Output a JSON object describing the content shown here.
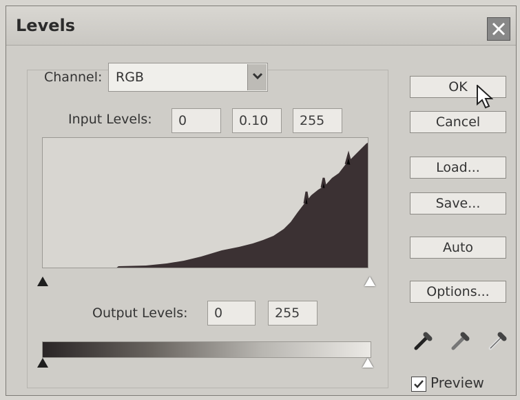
{
  "window": {
    "title": "Levels"
  },
  "channel": {
    "label": "Channel:",
    "value": "RGB"
  },
  "input_levels": {
    "label": "Input Levels:",
    "black": "0",
    "gamma": "0.10",
    "white": "255"
  },
  "output_levels": {
    "label": "Output Levels:",
    "black": "0",
    "white": "255"
  },
  "buttons": {
    "ok": "OK",
    "cancel": "Cancel",
    "load": "Load...",
    "save": "Save...",
    "auto": "Auto",
    "options": "Options..."
  },
  "preview": {
    "label": "Preview",
    "checked": true
  },
  "icons": {
    "close": "close-icon",
    "dropdown": "chevron-down-icon",
    "eyedropper_black": "black-eyedropper-icon",
    "eyedropper_gray": "gray-eyedropper-icon",
    "eyedropper_white": "white-eyedropper-icon",
    "cursor": "pointer-cursor-icon"
  },
  "colors": {
    "histogram_fill": "#3b3133",
    "dialog_bg": "#cfcdc8"
  }
}
